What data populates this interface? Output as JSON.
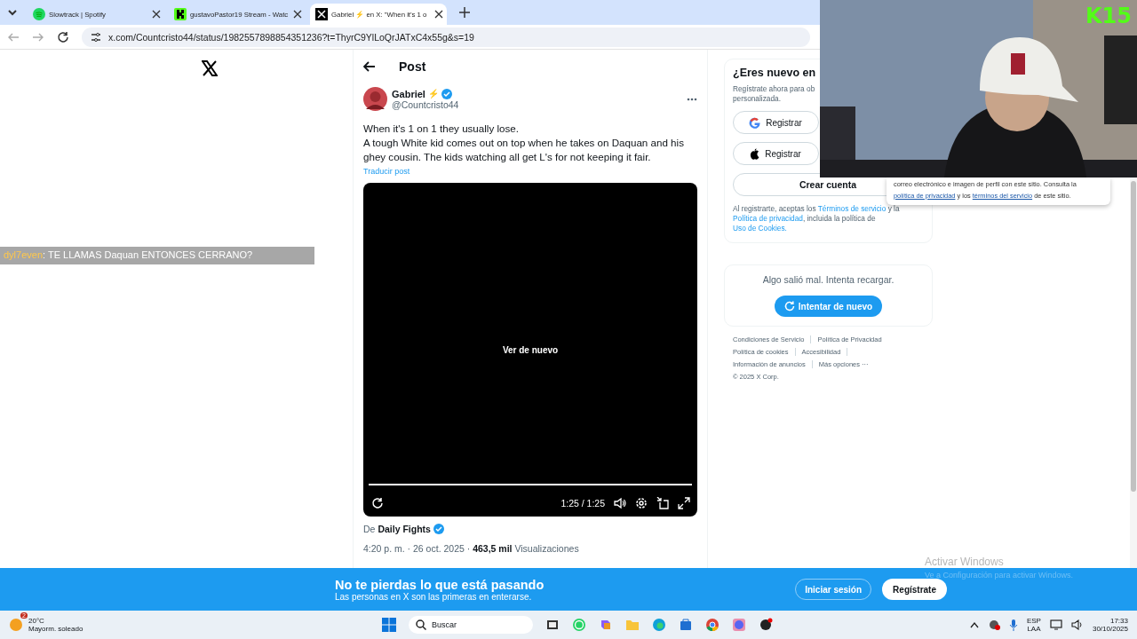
{
  "browser": {
    "tabs": [
      {
        "title": "Slowtrack | Spotify",
        "selected": false
      },
      {
        "title": "gustavoPastor19 Stream - Watc",
        "selected": false
      },
      {
        "title": "Gabriel ⚡ en X: \"When it's 1 o",
        "selected": true
      }
    ],
    "url": "x.com/Countcristo44/status/1982557898854351236?t=ThyrC9YlLoQrJATxC4x55g&s=19"
  },
  "overlay": {
    "chat": {
      "user": "dyl7even",
      "message": ": TE LLAMAS Daquan ENTONCES CERRANO?"
    },
    "logo": "K15"
  },
  "post": {
    "header": "Post",
    "author": {
      "name": "Gabriel",
      "badge": "⚡",
      "handle": "@Countcristo44"
    },
    "text_lines": [
      "When it's 1 on 1 they usually lose.",
      "A tough White kid comes out on top when he takes on Daquan and his ghey cousin. The kids watching all get L's for not keeping it fair."
    ],
    "translate": "Traducir post",
    "video": {
      "replay": "Ver de nuevo",
      "level": 1,
      "time": "1:25 / 1:25"
    },
    "source": {
      "prefix": "De",
      "name": "Daily Fights"
    },
    "meta": {
      "time": "4:20 p. m. · 26 oct. 2025 · ",
      "views": "463,5 mil",
      "views_label": " Visualizaciones"
    }
  },
  "signup": {
    "title": "¿Eres nuevo en",
    "subtitle_lines": [
      "Regístrate ahora para ob",
      "personalizada."
    ],
    "buttons": [
      {
        "kind": "google",
        "label": "Registrar"
      },
      {
        "kind": "apple",
        "label": "Registrar"
      },
      {
        "kind": "plain",
        "label": "Crear cuenta"
      }
    ],
    "terms": [
      {
        "text": "Al registrarte, aceptas los ",
        "link": false
      },
      {
        "text": "Términos de servicio",
        "link": true
      },
      {
        "text": " y la ",
        "link": false
      },
      {
        "text": "Política de privacidad",
        "link": true
      },
      {
        "text": ", incluida la política de ",
        "link": false
      },
      {
        "text": "Uso de Cookies.",
        "link": true
      }
    ]
  },
  "google_popup": [
    {
      "text": "correo electrónico e imagen de perfil con este sitio. Consulta la",
      "link": false
    },
    {
      "text": "política de privacidad",
      "link": true
    },
    {
      "text": " y los ",
      "link": false
    },
    {
      "text": "términos del servicio",
      "link": true
    },
    {
      "text": " de este sitio.",
      "link": false
    }
  ],
  "error_card": {
    "message": "Algo salió mal. Intenta recargar.",
    "button": "Intentar de nuevo"
  },
  "footer_links": [
    "Condiciones de Servicio",
    "Política de Privacidad",
    "Política de cookies",
    "Accesibilidad",
    "Información de anuncios",
    "Más opciones ···"
  ],
  "copyright": "© 2025 X Corp.",
  "banner": {
    "title": "No te pierdas lo que está pasando",
    "subtitle": "Las personas en X son las primeras en enterarse.",
    "login": "Iniciar sesión",
    "signup": "Regístrate"
  },
  "watermark": {
    "title": "Activar Windows",
    "subtitle": "Ve a Configuración para activar Windows."
  },
  "taskbar": {
    "weather": {
      "badge": "2",
      "temp": "20°C",
      "desc": "Mayorm. soleado"
    },
    "search": "Buscar",
    "lang": [
      "ESP",
      "LAA"
    ],
    "time": "17:33",
    "date": "30/10/2025"
  }
}
